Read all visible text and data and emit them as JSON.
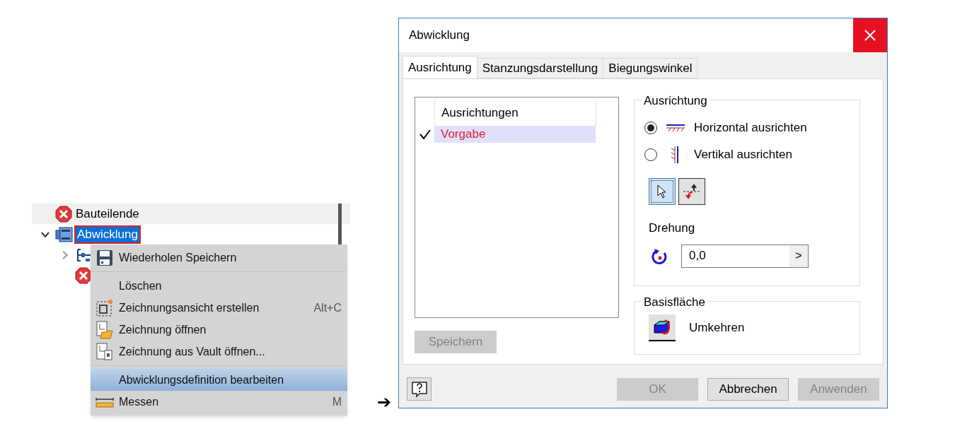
{
  "tree": {
    "items": [
      {
        "kind": "error",
        "label": "Bauteilende"
      },
      {
        "kind": "part",
        "label": "Abwicklung",
        "selected": true,
        "expanded": true,
        "children": [
          {
            "kind": "view",
            "expanded": false
          },
          {
            "kind": "error"
          }
        ]
      }
    ]
  },
  "context_menu": {
    "items": [
      {
        "kind": "save",
        "label": "Wiederholen Speichern",
        "selected": false
      },
      {
        "kind": "separator"
      },
      {
        "kind": "plain",
        "label": "Löschen",
        "selected": false
      },
      {
        "kind": "view",
        "label": "Zeichnungsansicht erstellen",
        "shortcut": "Alt+C",
        "selected": false
      },
      {
        "kind": "open",
        "label": "Zeichnung öffnen",
        "selected": false
      },
      {
        "kind": "vault",
        "label": "Zeichnung aus Vault öffnen...",
        "selected": false
      },
      {
        "kind": "separator"
      },
      {
        "kind": "plain",
        "label": "Abwicklungsdefinition bearbeiten",
        "selected": true
      },
      {
        "kind": "measure",
        "label": "Messen",
        "shortcut": "M",
        "selected": false
      }
    ]
  },
  "arrow": "➔",
  "dialog": {
    "title": "Abwicklung",
    "tabs": [
      {
        "label": "Ausrichtung",
        "selected": true
      },
      {
        "label": "Stanzungsdarstellung",
        "selected": false
      },
      {
        "label": "Biegungswinkel",
        "selected": false
      }
    ],
    "list": {
      "column": "Ausrichtungen",
      "rows": [
        {
          "label": "Vorgabe",
          "checked": true,
          "selected": true
        }
      ]
    },
    "save_button": {
      "label": "Speichern",
      "disabled": true
    },
    "orientation_group": {
      "title": "Ausrichtung",
      "options": [
        {
          "label": "Horizontal ausrichten",
          "kind": "horizontal",
          "selected": true
        },
        {
          "label": "Vertikal ausrichten",
          "kind": "vertical",
          "selected": false
        }
      ],
      "tools": [
        {
          "kind": "select",
          "selected": true
        },
        {
          "kind": "flip",
          "selected": false
        }
      ],
      "rotation_label": "Drehung",
      "rotation": {
        "value": "0,0",
        "button": ">"
      }
    },
    "base_group": {
      "title": "Basisfläche",
      "button": "Umkehren"
    },
    "buttons": [
      {
        "label": "OK",
        "disabled": true
      },
      {
        "label": "Abbrechen",
        "disabled": false
      },
      {
        "label": "Anwenden",
        "disabled": true
      }
    ]
  }
}
